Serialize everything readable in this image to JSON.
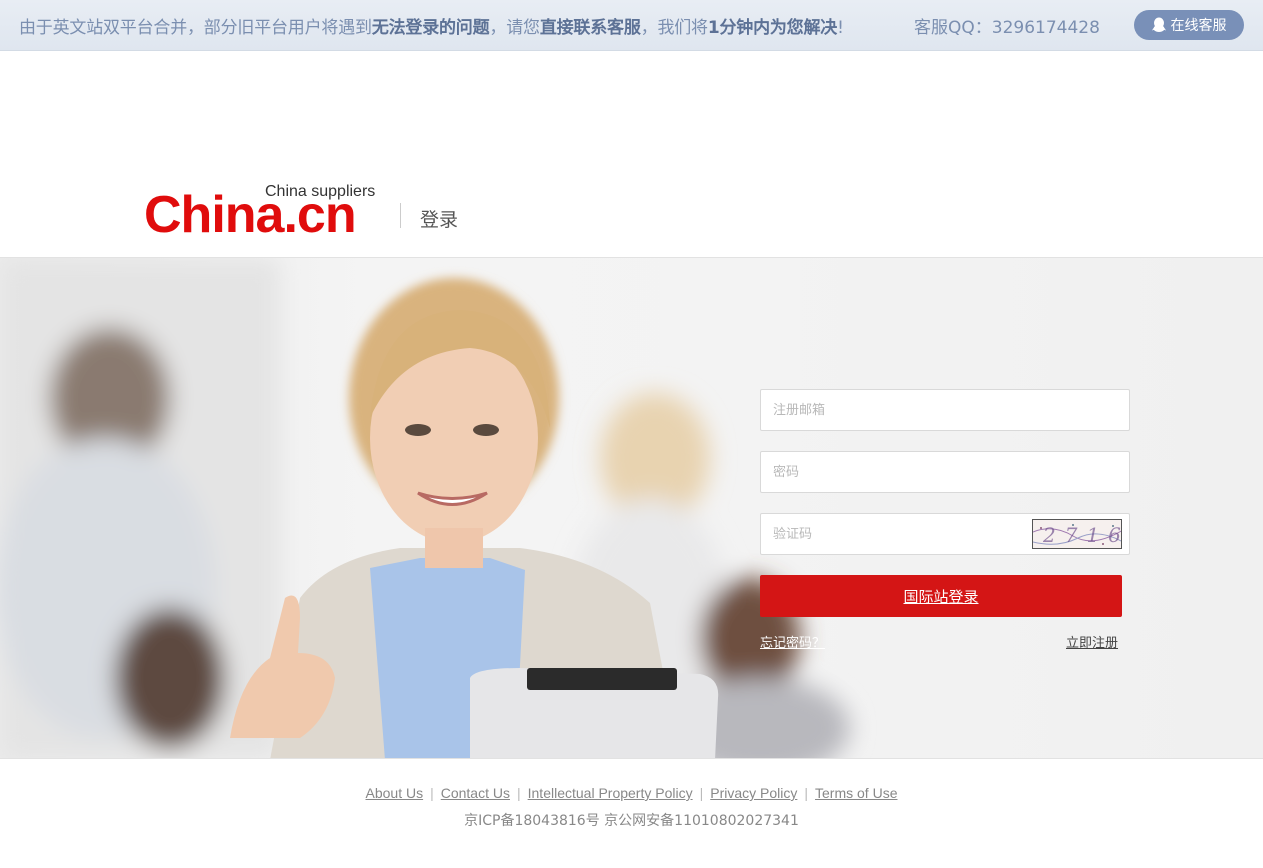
{
  "notice": {
    "part1": "由于英文站双平台合并，部分旧平台用户将遇到",
    "bold1": "无法登录的问题",
    "part2": "，请您",
    "bold2": "直接联系客服",
    "part3": "，我们将",
    "bold3": "1分钟内为您解决",
    "part4": "!",
    "qq": "客服QQ：3296174428",
    "online_button": "在线客服"
  },
  "header": {
    "logo_main": "China.cn",
    "logo_sub": "China suppliers",
    "title": "登录"
  },
  "form": {
    "email_placeholder": "注册邮箱",
    "password_placeholder": "密码",
    "captcha_placeholder": "验证码",
    "captcha_text": "2716",
    "login_button": "国际站登录",
    "forgot_password": "忘记密码？",
    "register": "立即注册"
  },
  "footer": {
    "links": [
      "About Us",
      "Contact Us",
      "Intellectual Property Policy",
      "Privacy Policy",
      "Terms of Use"
    ],
    "icp": "京ICP备18043816号 京公网安备11010802027341"
  },
  "colors": {
    "brand_red": "#e00c0c",
    "button_red": "#d41515",
    "notice_blue": "#7990b8"
  }
}
